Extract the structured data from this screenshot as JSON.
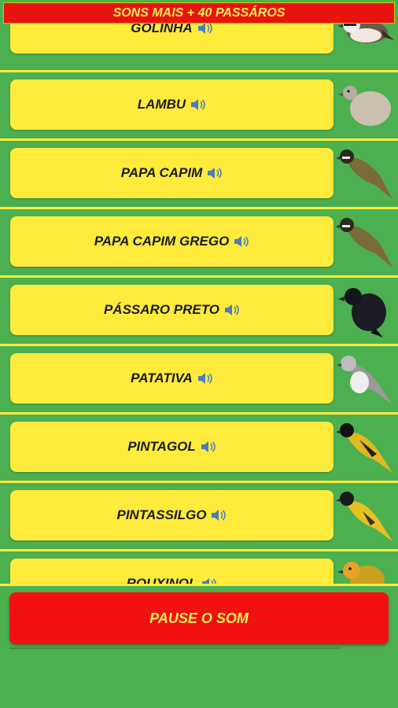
{
  "header": {
    "title": "SONS MAIS + 40 PASSÁROS"
  },
  "birds": [
    {
      "label": "GOLINHA",
      "icon": "bird-golinha-icon"
    },
    {
      "label": "LAMBU",
      "icon": "bird-lambu-icon"
    },
    {
      "label": "PAPA CAPIM",
      "icon": "bird-papa-capim-icon"
    },
    {
      "label": "PAPA CAPIM GREGO",
      "icon": "bird-papa-capim-grego-icon"
    },
    {
      "label": "PÁSSARO PRETO",
      "icon": "bird-passaro-preto-icon"
    },
    {
      "label": "PATATIVA",
      "icon": "bird-patativa-icon"
    },
    {
      "label": "PINTAGOL",
      "icon": "bird-pintagol-icon"
    },
    {
      "label": "PINTASSILGO",
      "icon": "bird-pintassilgo-icon"
    },
    {
      "label": "ROUXINOL",
      "icon": "bird-rouxinol-icon"
    }
  ],
  "footer": {
    "pause_label": "PAUSE O SOM"
  },
  "colors": {
    "background": "#4caf50",
    "button": "#ffeb3b",
    "header": "#e8130f",
    "pause": "#f21010"
  }
}
